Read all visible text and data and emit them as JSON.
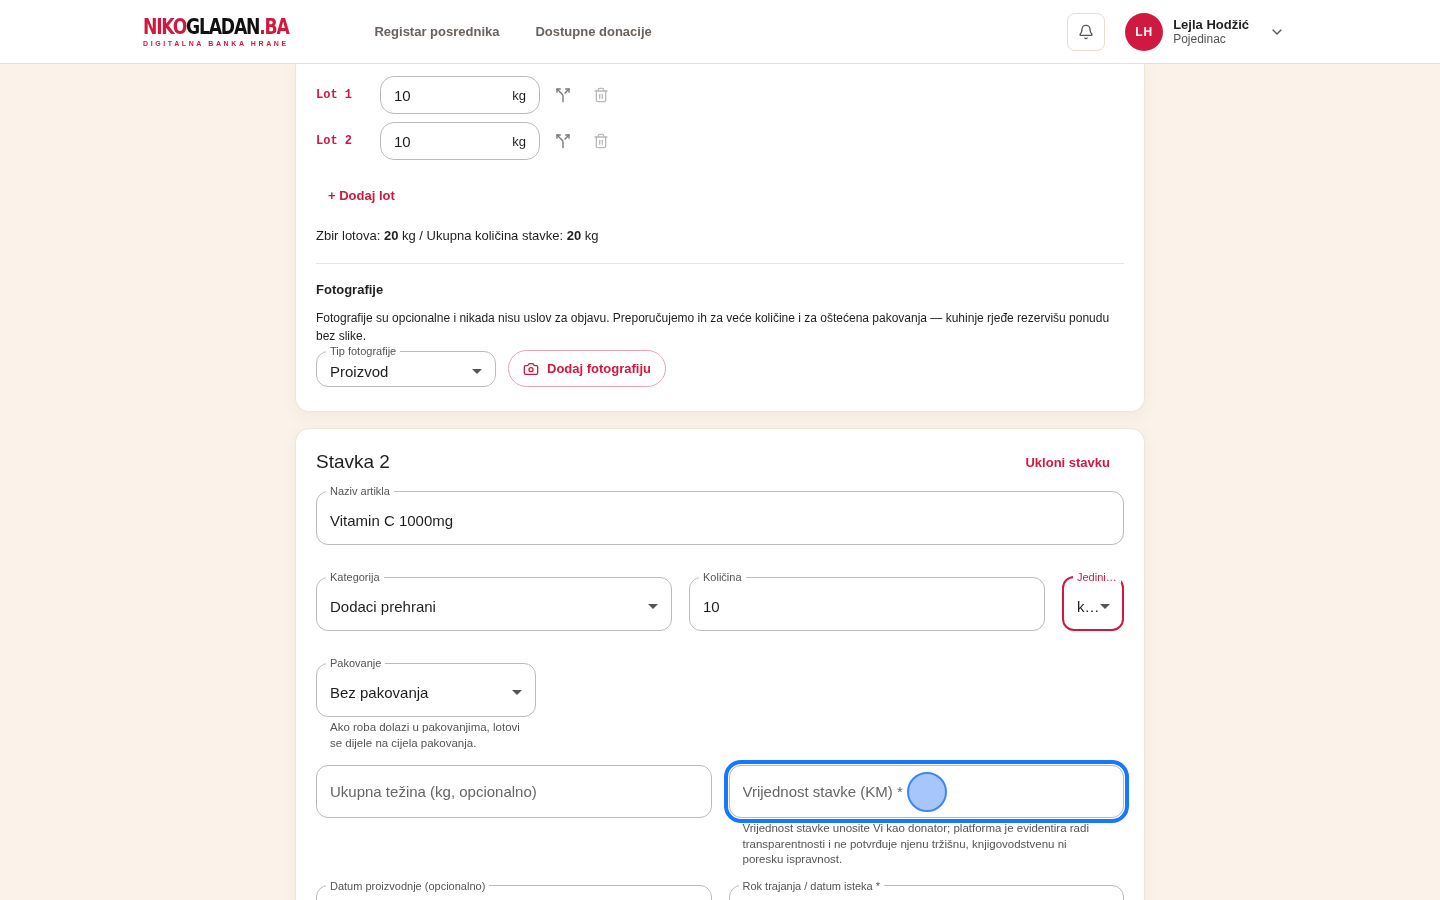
{
  "header": {
    "logo": {
      "part_1": "NIKO",
      "part_2": "GLADAN",
      "part_3": ".BA",
      "tagline": "DIGITALNA BANKA HRANE"
    },
    "nav": [
      "Registar posrednika",
      "Dostupne donacije"
    ],
    "user": {
      "initials": "LH",
      "name": "Lejla Hodžić",
      "role": "Pojedinac"
    }
  },
  "item_1": {
    "lots": [
      {
        "label": "Lot 1",
        "value": "10",
        "unit": "kg"
      },
      {
        "label": "Lot 2",
        "value": "10",
        "unit": "kg"
      }
    ],
    "add_lot": "+ Dodaj lot",
    "summary": "Zbir lotova: **20** kg / Ukupna količina stavke: **20** kg",
    "photos": {
      "title": "Fotografije",
      "description": "Fotografije su opcionalne i nikada nisu uslov za objavu. Preporučujemo ih za veće količine i za oštećena pakovanja — kuhinje rjeđe rezervišu ponudu bez slike.",
      "type_field": {
        "label": "Tip fotografije",
        "value": "Proizvod"
      },
      "add_button": "Dodaj fotografiju"
    }
  },
  "item_2": {
    "title": "Stavka 2",
    "remove": "Ukloni stavku",
    "rows": [
      [
        {
          "kind": "text",
          "label": "Naziv artikla",
          "value": "Vitamin C 1000mg",
          "invalid": false,
          "focused": false
        }
      ],
      [
        {
          "kind": "select",
          "label": "Kategorija",
          "value": "Dodaci prehrani",
          "invalid": false,
          "focused": false
        },
        {
          "kind": "text",
          "label": "Količina",
          "value": "10",
          "invalid": false,
          "focused": false
        },
        {
          "kind": "select",
          "label": "Jedini…",
          "value": "k…",
          "invalid": true,
          "focused": false
        }
      ],
      [
        {
          "kind": "select",
          "label": "Pakovanje",
          "value": "Bez pakovanja",
          "invalid": false,
          "focused": false,
          "helper": "Ako roba dolazi u pakovanjima, lotovi se dijele na cijela pakovanja."
        }
      ],
      [
        {
          "kind": "text",
          "placeholder": "Ukupna težina (kg, opcionalno)",
          "invalid": false,
          "focused": false
        },
        {
          "kind": "text",
          "placeholder": "Vrijednost stavke (KM) *",
          "invalid": false,
          "focused": true,
          "helper": "Vrijednost stavke unosite Vi kao donator; platforma je evidentira radi transparentnosti i ne potvrđuje njenu tržišnu, knjigovodstvenu ni poresku ispravnost."
        }
      ],
      [
        {
          "kind": "date",
          "label": "Datum proizvodnje (opcionalno)"
        },
        {
          "kind": "date",
          "label": "Rok trajanja / datum isteka *"
        }
      ]
    ]
  }
}
